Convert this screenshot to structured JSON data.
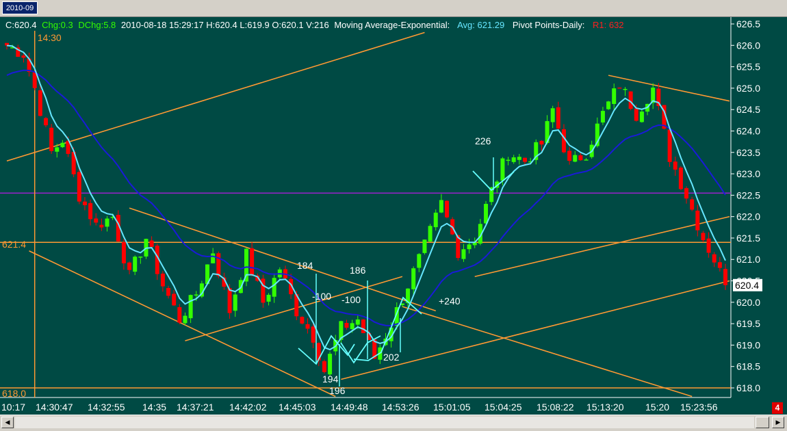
{
  "tab": {
    "label": "2010-09"
  },
  "header": {
    "close": "C:620.4",
    "chg": "Chg:0.3",
    "dchg": "DChg:5.8",
    "info": "2010-08-18 15:29:17 H:620.4 L:619.9 O:620.1 V:216",
    "ma_label": "Moving Average-Exponential:",
    "ma_value": "Avg: 621.29",
    "pivot_label": "Pivot Points-Daily:",
    "pivot_value": "R1: 632"
  },
  "colors": {
    "background": "#004a44",
    "up": "#33ff00",
    "down": "#ff0000",
    "fast_ma": "#66e6ff",
    "slow_ma": "#1a1ad9",
    "trendline": "#ff9933",
    "pivot": "#9922cc",
    "annotation": "#66ffff"
  },
  "status": {
    "badge": "4"
  },
  "chart_data": {
    "type": "candlestick",
    "y_ticks": [
      "626.5",
      "626.0",
      "625.5",
      "625.0",
      "624.5",
      "624.0",
      "623.5",
      "623.0",
      "622.5",
      "622.0",
      "621.5",
      "621.0",
      "620.5",
      "620.0",
      "619.5",
      "619.0",
      "618.5",
      "618.0"
    ],
    "ylim": [
      617.8,
      626.6
    ],
    "x_ticks": [
      "10:17",
      "14:30:47",
      "14:32:55",
      "14:35",
      "14:37:21",
      "14:42:02",
      "14:45:03",
      "14:49:48",
      "14:53:26",
      "15:01:05",
      "15:04:25",
      "15:08:22",
      "15:13:20",
      "15:20",
      "15:23:56"
    ],
    "last_price_label": "620.4",
    "last_price": 620.4,
    "horizontal_levels": [
      {
        "label": "621.4",
        "value": 621.4
      },
      {
        "label": "618.0",
        "value": 618.0
      },
      {
        "label": "",
        "value": 622.55
      }
    ],
    "vertical_marker": {
      "label": "14:30",
      "bar_index": 5
    },
    "annotations": [
      "184",
      "186",
      "-100",
      "-100",
      "+240",
      "226",
      "194",
      "196",
      "202"
    ],
    "bars_count": 130,
    "close_path": [
      {
        "i": 0,
        "v": 626.0
      },
      {
        "i": 3,
        "v": 625.8
      },
      {
        "i": 5,
        "v": 625.0
      },
      {
        "i": 8,
        "v": 623.5
      },
      {
        "i": 10,
        "v": 623.8
      },
      {
        "i": 13,
        "v": 622.5
      },
      {
        "i": 16,
        "v": 621.8
      },
      {
        "i": 19,
        "v": 622.0
      },
      {
        "i": 22,
        "v": 620.6
      },
      {
        "i": 25,
        "v": 621.5
      },
      {
        "i": 28,
        "v": 620.4
      },
      {
        "i": 31,
        "v": 619.6
      },
      {
        "i": 34,
        "v": 620.2
      },
      {
        "i": 37,
        "v": 621.2
      },
      {
        "i": 40,
        "v": 619.8
      },
      {
        "i": 43,
        "v": 621.1
      },
      {
        "i": 46,
        "v": 620.0
      },
      {
        "i": 49,
        "v": 620.8
      },
      {
        "i": 52,
        "v": 619.8
      },
      {
        "i": 55,
        "v": 619.2
      },
      {
        "i": 57,
        "v": 618.4
      },
      {
        "i": 60,
        "v": 619.4
      },
      {
        "i": 63,
        "v": 619.6
      },
      {
        "i": 66,
        "v": 618.7
      },
      {
        "i": 69,
        "v": 619.5
      },
      {
        "i": 72,
        "v": 620.4
      },
      {
        "i": 75,
        "v": 621.3
      },
      {
        "i": 78,
        "v": 622.3
      },
      {
        "i": 81,
        "v": 621.2
      },
      {
        "i": 84,
        "v": 621.5
      },
      {
        "i": 87,
        "v": 622.6
      },
      {
        "i": 90,
        "v": 623.5
      },
      {
        "i": 93,
        "v": 623.3
      },
      {
        "i": 96,
        "v": 623.7
      },
      {
        "i": 98,
        "v": 624.5
      },
      {
        "i": 101,
        "v": 623.2
      },
      {
        "i": 104,
        "v": 623.5
      },
      {
        "i": 107,
        "v": 624.4
      },
      {
        "i": 110,
        "v": 625.1
      },
      {
        "i": 113,
        "v": 624.4
      },
      {
        "i": 116,
        "v": 625.0
      },
      {
        "i": 119,
        "v": 623.4
      },
      {
        "i": 122,
        "v": 622.5
      },
      {
        "i": 125,
        "v": 621.5
      },
      {
        "i": 127,
        "v": 621.0
      },
      {
        "i": 129,
        "v": 620.4
      }
    ],
    "trendlines": [
      {
        "x1": 0,
        "y1": 623.3,
        "x2": 75,
        "y2": 626.3
      },
      {
        "x1": 4,
        "y1": 621.2,
        "x2": 59,
        "y2": 617.8
      },
      {
        "x1": 22,
        "y1": 622.2,
        "x2": 77,
        "y2": 619.8
      },
      {
        "x1": 32,
        "y1": 619.1,
        "x2": 71,
        "y2": 620.6
      },
      {
        "x1": 60,
        "y1": 618.2,
        "x2": 130,
        "y2": 620.5
      },
      {
        "x1": 84,
        "y1": 620.6,
        "x2": 130,
        "y2": 622.0
      },
      {
        "x1": 71,
        "y1": 619.9,
        "x2": 123,
        "y2": 617.8
      },
      {
        "x1": 108,
        "y1": 625.3,
        "x2": 130,
        "y2": 624.7
      }
    ]
  }
}
